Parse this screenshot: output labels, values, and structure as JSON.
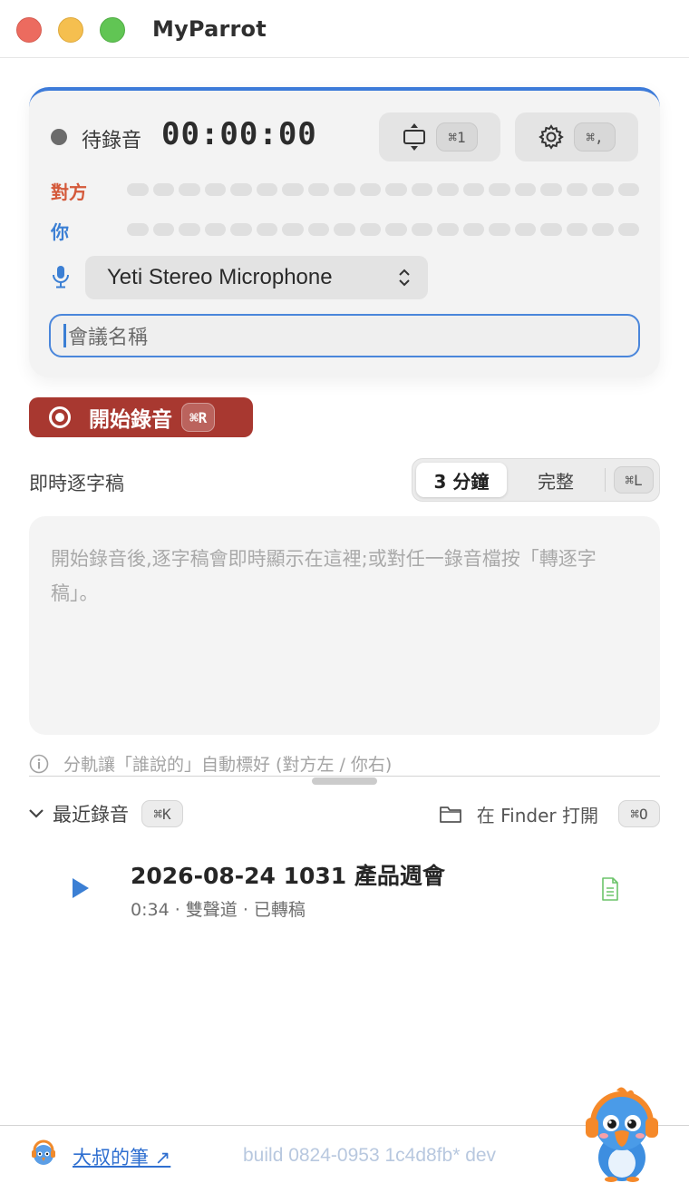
{
  "window": {
    "title": "MyParrot"
  },
  "recorder": {
    "status_label": "待錄音",
    "timer": "00:00:00",
    "layout_shortcut": "⌘1",
    "settings_shortcut": "⌘,",
    "channel_other_label": "對方",
    "channel_you_label": "你",
    "microphone_selected": "Yeti Stereo Microphone",
    "meeting_name_placeholder": "會議名稱"
  },
  "record_button": {
    "label": "開始錄音",
    "shortcut": "⌘R"
  },
  "transcript": {
    "title": "即時逐字稿",
    "segment_options": [
      "3 分鐘",
      "完整"
    ],
    "segment_selected": "3 分鐘",
    "shortcut": "⌘L",
    "placeholder": "開始錄音後,逐字稿會即時顯示在這裡;或對任一錄音檔按「轉逐字稿」。",
    "hint": "分軌讓「誰說的」自動標好 (對方左 / 你右)"
  },
  "recent": {
    "title": "最近錄音",
    "shortcut": "⌘K",
    "open_finder_label": "在 Finder 打開",
    "open_finder_shortcut": "⌘O",
    "items": [
      {
        "title": "2026-08-24 1031 產品週會",
        "meta": "0:34 · 雙聲道 · 已轉稿"
      }
    ]
  },
  "footer": {
    "link_label": "大叔的筆 ↗",
    "build": "build 0824-0953 1c4d8fb* dev"
  },
  "colors": {
    "accent": "#3d7bd9",
    "record": "#a83830",
    "other_channel": "#d4593a",
    "you_channel": "#3b7fd4",
    "transcribed_doc": "#6cc46a"
  },
  "icons": [
    "move-window-icon",
    "gear-icon",
    "microphone-icon",
    "select-chevron-icon",
    "record-icon",
    "info-icon",
    "chevron-down-icon",
    "folder-icon",
    "play-icon",
    "document-icon",
    "parrot-avatar-icon",
    "parrot-mascot"
  ]
}
